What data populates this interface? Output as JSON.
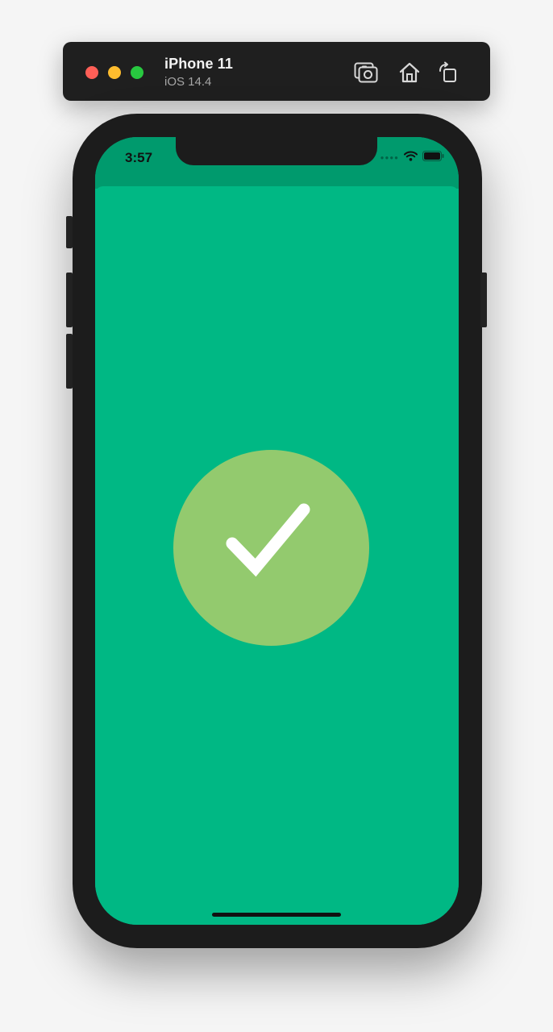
{
  "simulator": {
    "device_name": "iPhone 11",
    "os_version": "iOS 14.4",
    "buttons": [
      {
        "name": "screenshot-button",
        "icon": "screenshot-icon"
      },
      {
        "name": "home-button",
        "icon": "home-icon"
      },
      {
        "name": "rotate-button",
        "icon": "rotate-icon"
      }
    ]
  },
  "status_bar": {
    "time": "3:57",
    "icons": [
      "cellular-dots-icon",
      "wifi-icon",
      "battery-icon"
    ]
  },
  "screen": {
    "background_color": "#00b884",
    "status_strip_color": "#009a6d",
    "success_icon": "checkmark-icon",
    "success_circle_color": "#93ca6e",
    "checkmark_color": "#ffffff"
  }
}
